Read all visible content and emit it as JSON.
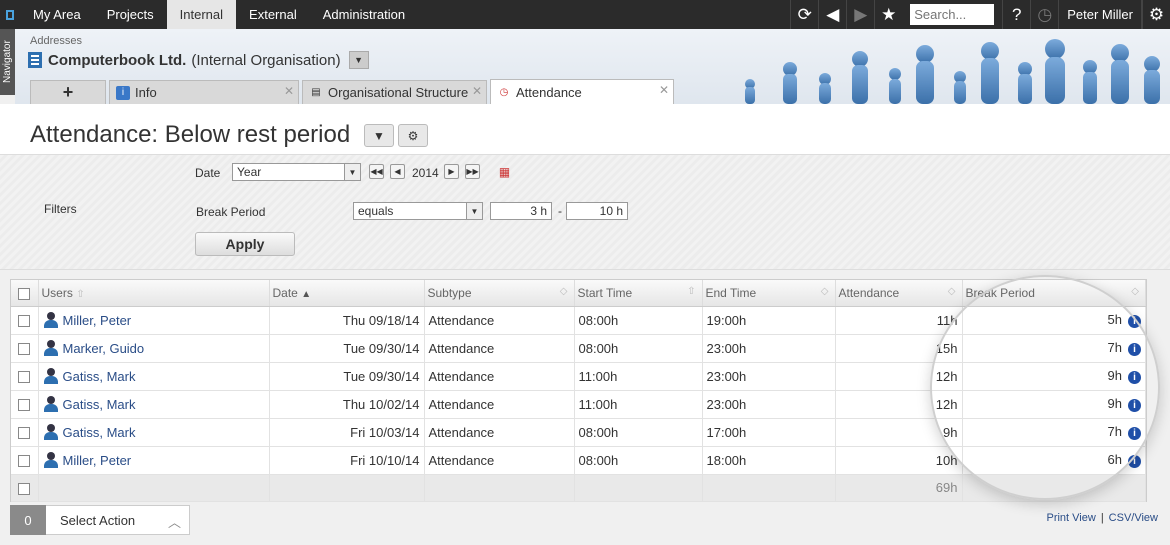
{
  "topbar": {
    "menu": [
      "My Area",
      "Projects",
      "Internal",
      "External",
      "Administration"
    ],
    "active_index": 2,
    "search_placeholder": "Search...",
    "user_name": "Peter Miller"
  },
  "navigator_label": "Navigator",
  "header": {
    "breadcrumb": "Addresses",
    "org_name": "Computerbook Ltd.",
    "org_type": "(Internal Organisation)"
  },
  "tabs": [
    {
      "label": "Info"
    },
    {
      "label": "Organisational Structure"
    },
    {
      "label": "Attendance"
    }
  ],
  "page_title": "Attendance: Below rest period",
  "filters": {
    "date_label": "Date",
    "date_period": "Year",
    "year": "2014",
    "filters_label": "Filters",
    "break_period_label": "Break Period",
    "operator": "equals",
    "from_value": "3 h",
    "range_separator": "-",
    "to_value": "10 h",
    "apply_label": "Apply"
  },
  "table": {
    "columns": [
      "Users",
      "Date",
      "Subtype",
      "Start Time",
      "End Time",
      "Attendance",
      "Break Period"
    ],
    "rows": [
      {
        "user": "Miller, Peter",
        "date": "Thu 09/18/14",
        "subtype": "Attendance",
        "start": "08:00h",
        "end": "19:00h",
        "attendance": "11h",
        "break": "5h"
      },
      {
        "user": "Marker, Guido",
        "date": "Tue 09/30/14",
        "subtype": "Attendance",
        "start": "08:00h",
        "end": "23:00h",
        "attendance": "15h",
        "break": "7h"
      },
      {
        "user": "Gatiss, Mark",
        "date": "Tue 09/30/14",
        "subtype": "Attendance",
        "start": "11:00h",
        "end": "23:00h",
        "attendance": "12h",
        "break": "9h"
      },
      {
        "user": "Gatiss, Mark",
        "date": "Thu 10/02/14",
        "subtype": "Attendance",
        "start": "11:00h",
        "end": "23:00h",
        "attendance": "12h",
        "break": "9h"
      },
      {
        "user": "Gatiss, Mark",
        "date": "Fri 10/03/14",
        "subtype": "Attendance",
        "start": "08:00h",
        "end": "17:00h",
        "attendance": "9h",
        "break": "7h"
      },
      {
        "user": "Miller, Peter",
        "date": "Fri 10/10/14",
        "subtype": "Attendance",
        "start": "08:00h",
        "end": "18:00h",
        "attendance": "10h",
        "break": "6h"
      }
    ],
    "total_attendance": "69h"
  },
  "bottom": {
    "selected_count": "0",
    "select_action_label": "Select Action",
    "print_view": "Print View",
    "csv_view": "CSV/View"
  }
}
